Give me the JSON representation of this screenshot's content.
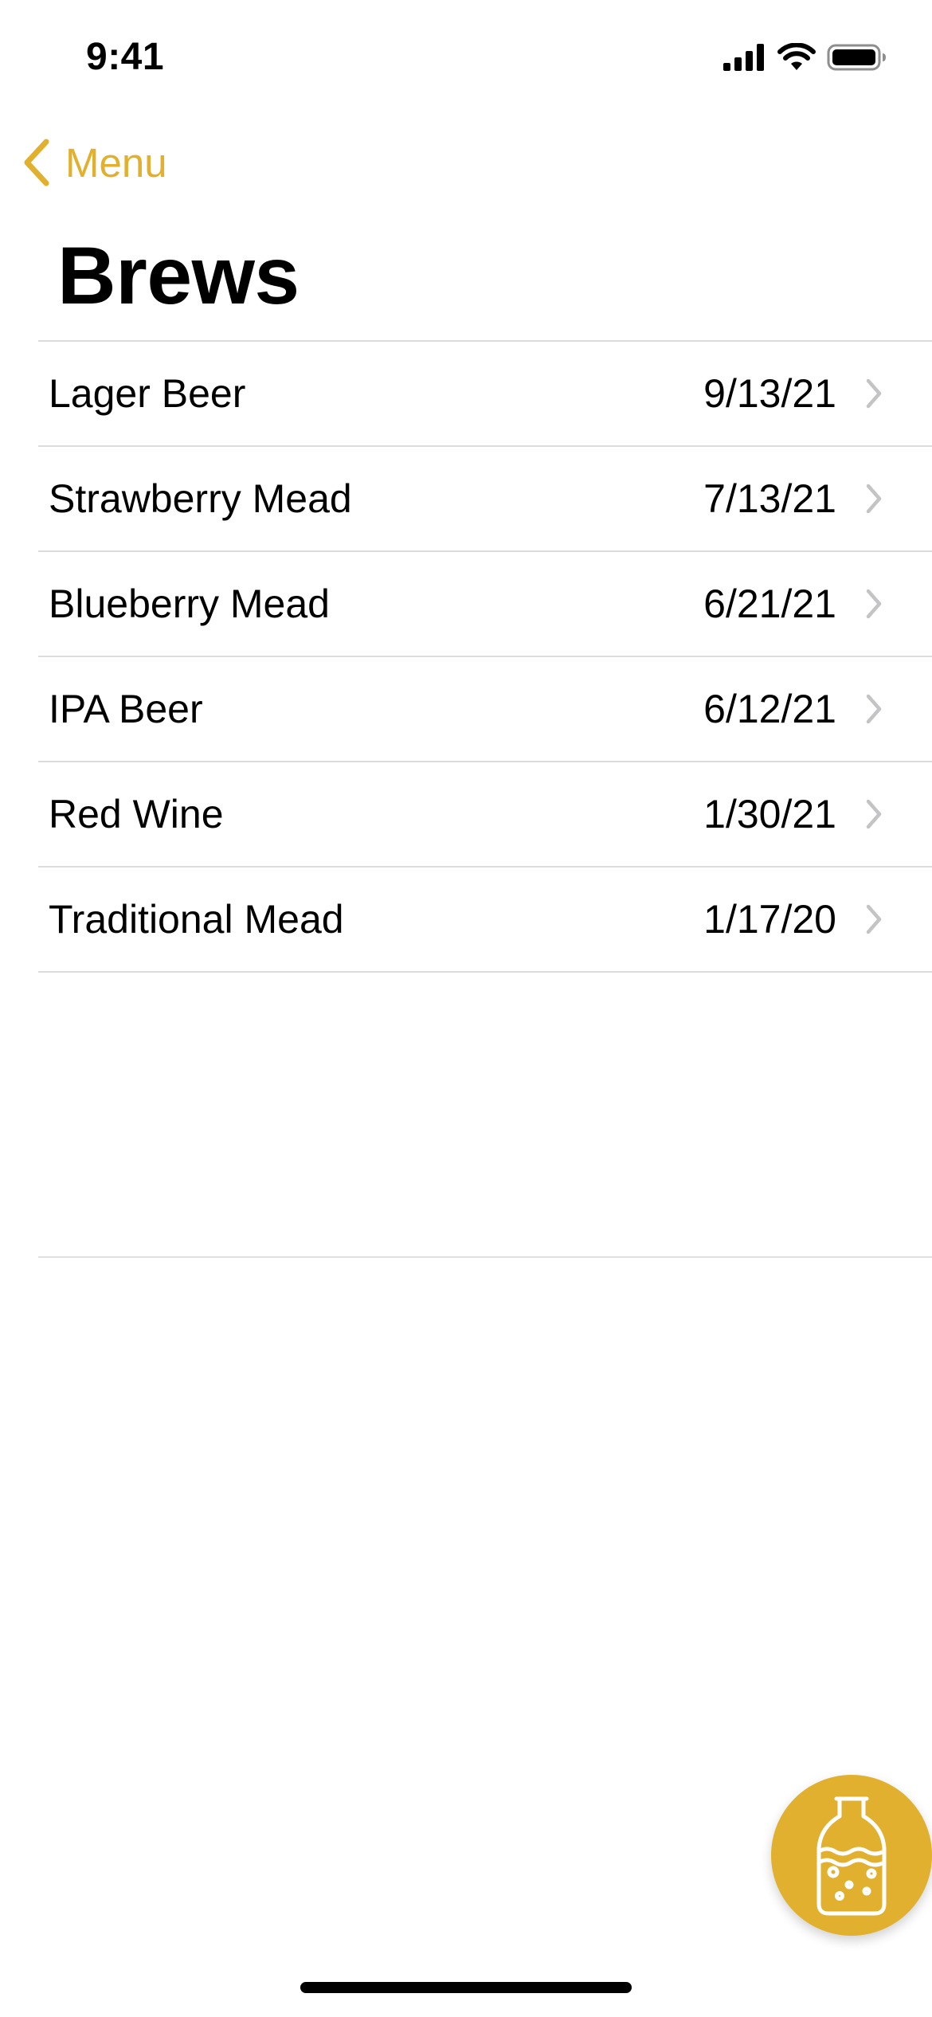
{
  "status_bar": {
    "time": "9:41",
    "icons": [
      "cellular-signal-icon",
      "wifi-icon",
      "battery-icon"
    ]
  },
  "nav": {
    "back_label": "Menu",
    "back_icon": "chevron-left-icon",
    "title": "Brews"
  },
  "brews": [
    {
      "name": "Lager Beer",
      "date": "9/13/21"
    },
    {
      "name": "Strawberry Mead",
      "date": "7/13/21"
    },
    {
      "name": "Blueberry Mead",
      "date": "6/21/21"
    },
    {
      "name": "IPA Beer",
      "date": "6/12/21"
    },
    {
      "name": "Red Wine",
      "date": "1/30/21"
    },
    {
      "name": "Traditional Mead",
      "date": "1/17/20"
    }
  ],
  "fab": {
    "icon": "carboy-bottle-icon"
  },
  "colors": {
    "accent": "#E0B02E",
    "separator": "#DCDCDC",
    "chevron": "#C4C4C6"
  }
}
